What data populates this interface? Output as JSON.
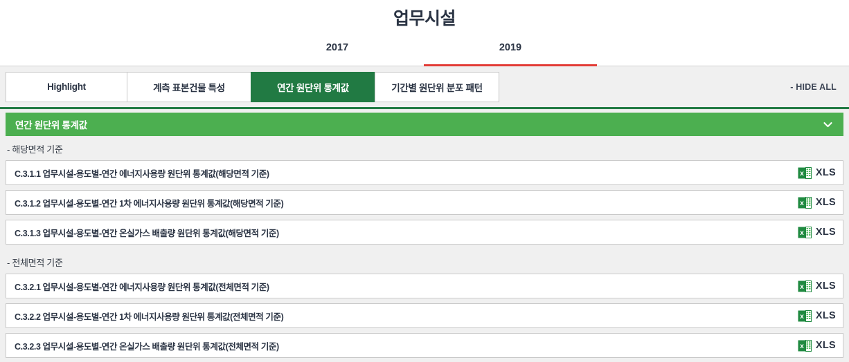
{
  "header": {
    "title": "업무시설"
  },
  "year_tabs": {
    "items": [
      {
        "label": "2017",
        "active": false
      },
      {
        "label": "2019",
        "active": true
      }
    ],
    "active_color": "#e23b35"
  },
  "section_tabs": {
    "items": [
      {
        "label": "Highlight",
        "active": false
      },
      {
        "label": "계측 표본건물 특성",
        "active": false
      },
      {
        "label": "연간 원단위 통계값",
        "active": true
      },
      {
        "label": "기간별 원단위 분포 패턴",
        "active": false
      }
    ],
    "hide_all_label": "- HIDE ALL",
    "active_color": "#217a43"
  },
  "section": {
    "title": "연간 원단위 통계값",
    "bar_color": "#4caf50",
    "toggle_icon": "chevron-down-icon"
  },
  "groups": [
    {
      "label": "- 해당면적 기준",
      "rows": [
        {
          "label": "C.3.1.1 업무시설-용도별-연간 에너지사용량 원단위 통계값(해당면적 기준)",
          "download_label": "XLS",
          "download_icon": "excel-xls-icon"
        },
        {
          "label": "C.3.1.2 업무시설-용도별-연간 1차 에너지사용량 원단위 통계값(해당면적 기준)",
          "download_label": "XLS",
          "download_icon": "excel-xls-icon"
        },
        {
          "label": "C.3.1.3 업무시설-용도별-연간 온실가스 배출량 원단위 통계값(해당면적 기준)",
          "download_label": "XLS",
          "download_icon": "excel-xls-icon"
        }
      ]
    },
    {
      "label": "- 전체면적 기준",
      "rows": [
        {
          "label": "C.3.2.1 업무시설-용도별-연간 에너지사용량 원단위 통계값(전체면적 기준)",
          "download_label": "XLS",
          "download_icon": "excel-xls-icon"
        },
        {
          "label": "C.3.2.2 업무시설-용도별-연간 1차 에너지사용량 원단위 통계값(전체면적 기준)",
          "download_label": "XLS",
          "download_icon": "excel-xls-icon"
        },
        {
          "label": "C.3.2.3 업무시설-용도별-연간 온실가스 배출량 원단위 통계값(전체면적 기준)",
          "download_label": "XLS",
          "download_icon": "excel-xls-icon"
        }
      ]
    }
  ]
}
